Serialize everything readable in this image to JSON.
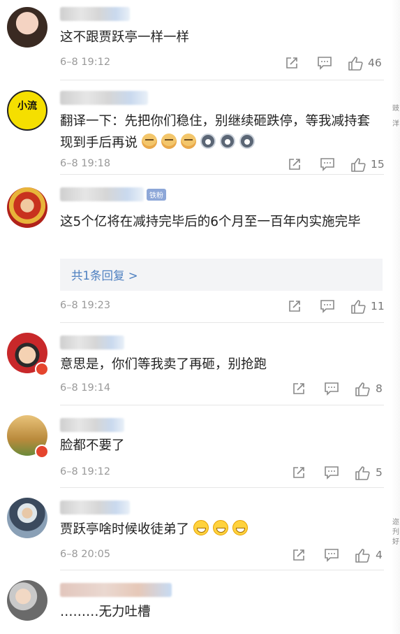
{
  "comments": [
    {
      "text": "这不跟贾跃亭一样一样",
      "time": "6–8 19:12",
      "likes": "46"
    },
    {
      "text": "翻译一下：先把你们稳住，别继续砸跌停，等我减持套现到手后再说",
      "time": "6–8 19:18",
      "likes": "15",
      "avatar_text": "小流"
    },
    {
      "text": "这5个亿将在减持完毕后的6个月至一百年内实施完毕",
      "time": "6–8 19:23",
      "likes": "11",
      "reply_label": "共1条回复 >",
      "tag": "铁粉"
    },
    {
      "text": "意思是，你们等我卖了再砸，别抢跑",
      "time": "6–8 19:14",
      "likes": "8"
    },
    {
      "text": "脸都不要了",
      "time": "6–8 19:12",
      "likes": "5"
    },
    {
      "text": "贾跃亭啥时候收徒弟了",
      "time": "6–8 20:05",
      "likes": "4"
    },
    {
      "text": "………无力吐槽"
    }
  ],
  "edge_fragments": [
    "豉",
    "洋",
    "迩",
    "刋",
    "好"
  ],
  "colors": {
    "link": "#4d7fc0",
    "meta": "#999999",
    "divider": "#e6e6e6"
  },
  "icons": [
    "share-icon",
    "comment-icon",
    "like-icon"
  ]
}
